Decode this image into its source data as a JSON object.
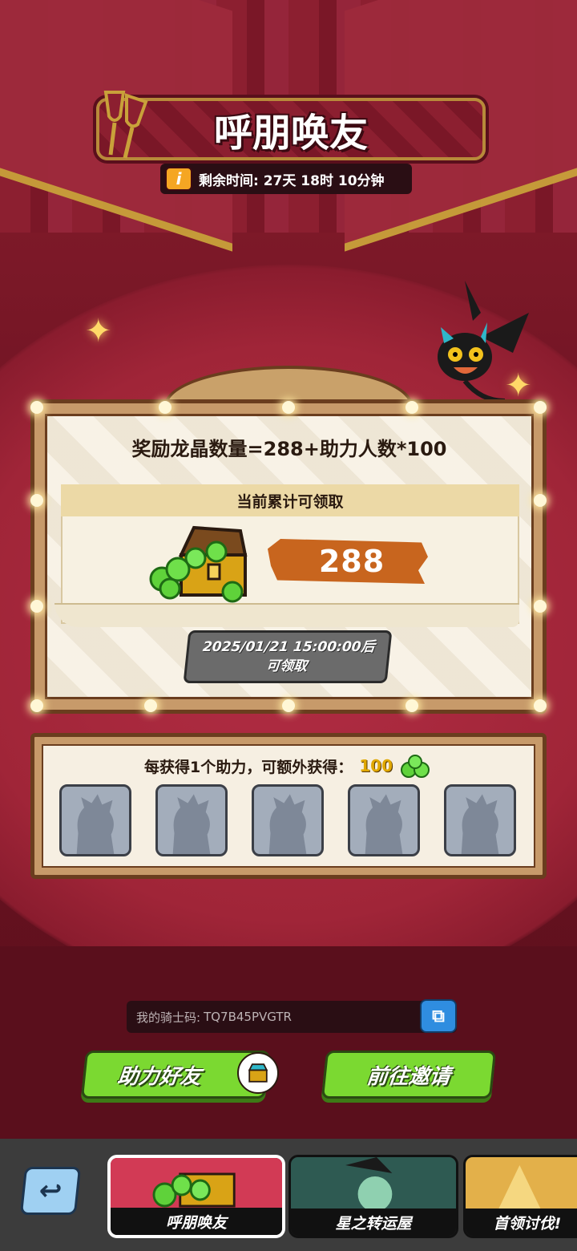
{
  "header": {
    "title": "呼朋唤友",
    "timer_info_icon": "i",
    "timer_text": "剩余时间: 27天 18时 10分钟"
  },
  "reward": {
    "formula": "奖励龙晶数量=288+助力人数*100",
    "card_header": "当前累计可领取",
    "amount": "288",
    "claim_button_line1": "2025/01/21 15:00:00后",
    "claim_button_line2": "可领取"
  },
  "helpers": {
    "bonus_text": "每获得1个助力，可额外获得：",
    "bonus_amount": "100",
    "slots": [
      "empty",
      "empty",
      "empty",
      "empty",
      "empty"
    ]
  },
  "code": {
    "label": "我的骑士码:",
    "value": "TQ7B45PVGTR"
  },
  "actions": {
    "help_friend": "助力好友",
    "go_invite": "前往邀请"
  },
  "nav": {
    "tabs": [
      {
        "label": "呼朋唤友",
        "active": true
      },
      {
        "label": "星之转运屋",
        "active": false
      },
      {
        "label": "首领讨伐!",
        "active": false
      }
    ]
  },
  "colors": {
    "background": "#7a1524",
    "accent_green": "#7bd931",
    "amount_orange": "#c8651e",
    "gold": "#c9a13a"
  }
}
